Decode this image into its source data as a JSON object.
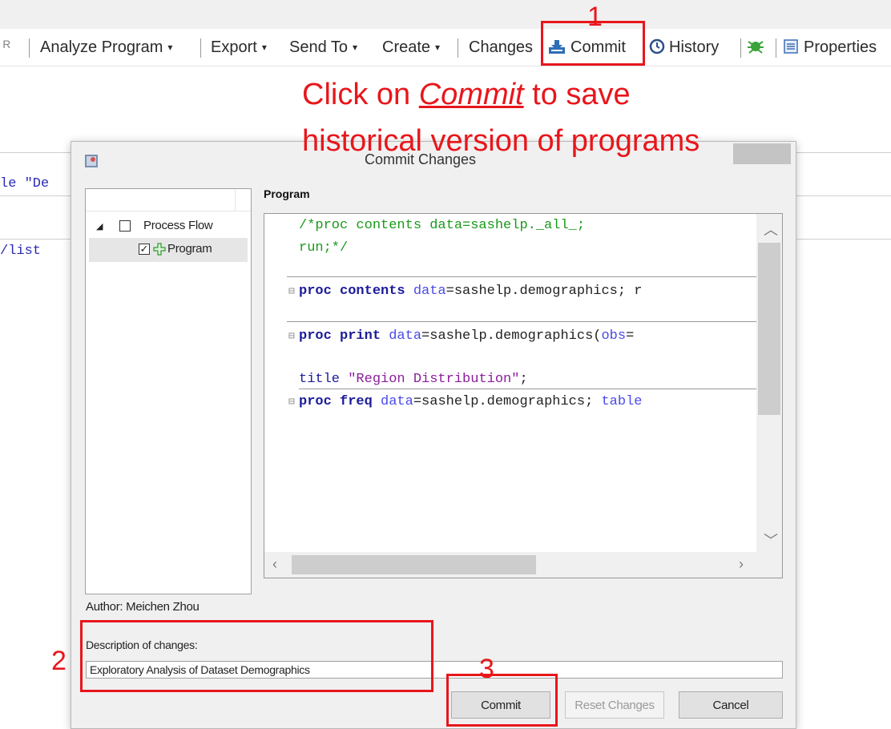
{
  "toolbar": {
    "items": [
      {
        "label": "Analyze Program"
      },
      {
        "label": "Export"
      },
      {
        "label": "Send To"
      },
      {
        "label": "Create"
      },
      {
        "label": "Changes"
      },
      {
        "label": "Commit"
      },
      {
        "label": "History"
      },
      {
        "label": "Properties"
      }
    ],
    "caret": "▾"
  },
  "annotations": {
    "step1": "1",
    "step2": "2",
    "step3": "3",
    "callout_prefix": "Click on ",
    "callout_emphasis": "Commit",
    "callout_suffix": " to save",
    "callout_line2": "historical version of programs",
    "color": "#e8161b"
  },
  "background_editor": {
    "line1": "le \"De",
    "line2": "/list"
  },
  "dialog": {
    "title": "Commit Changes",
    "tree": {
      "parent": {
        "label": "Process Flow",
        "checked": false
      },
      "child": {
        "label": "Program",
        "checked": true
      }
    },
    "program_label": "Program",
    "code": {
      "c1": "/*proc contents data=sashelp._all_;",
      "c2": "run;*/",
      "l3": {
        "kw": "proc contents",
        "attr": "data",
        "rest": "=sashelp.demographics; r"
      },
      "l4": {
        "kw": "proc print",
        "attr": "data",
        "rest": "=sashelp.demographics(",
        "attr2": "obs",
        "rest2": "="
      },
      "l5": {
        "kw": "title",
        "str": "\"Region Distribution\"",
        "rest": ";"
      },
      "l6": {
        "kw": "proc freq",
        "attr": "data",
        "rest": "=sashelp.demographics; ",
        "attr2": "table"
      }
    },
    "author": "Author: Meichen Zhou",
    "description_label": "Description of changes:",
    "description_value": "Exploratory Analysis of Dataset Demographics",
    "buttons": {
      "commit": "Commit",
      "reset": "Reset Changes",
      "cancel": "Cancel"
    }
  }
}
